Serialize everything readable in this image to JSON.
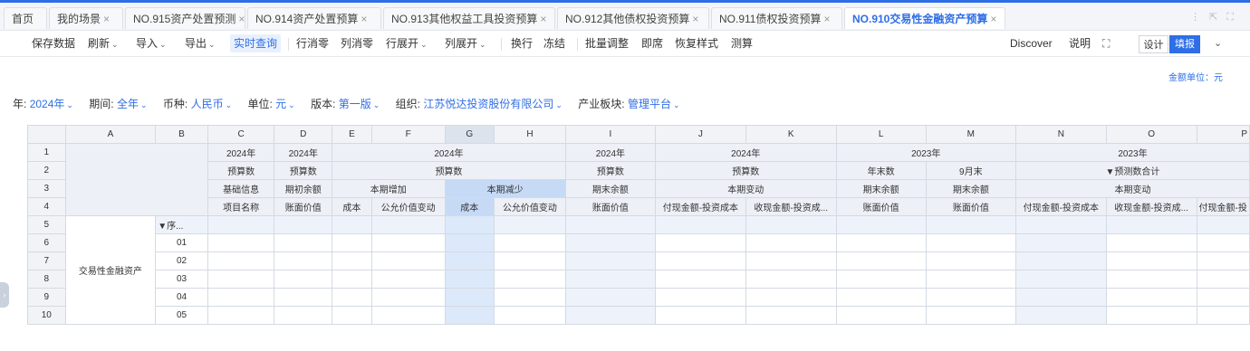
{
  "tabs": [
    {
      "label": "首页",
      "close": ""
    },
    {
      "label": "我的场景",
      "close": "×"
    },
    {
      "label": "NO.915资产处置预测",
      "close": "×"
    },
    {
      "label": "NO.914资产处置预算",
      "close": "×"
    },
    {
      "label": "NO.913其他权益工具投资预算",
      "close": "×"
    },
    {
      "label": "NO.912其他债权投资预算",
      "close": "×"
    },
    {
      "label": "NO.911债权投资预算",
      "close": "×"
    },
    {
      "label": "NO.910交易性金融资产预算",
      "close": "×"
    }
  ],
  "toolbar": {
    "save": "保存数据",
    "refresh": "刷新",
    "import": "导入",
    "export": "导出",
    "realtime": "实时查询",
    "row_zero": "行消零",
    "col_zero": "列消零",
    "row_expand": "行展开",
    "col_expand": "列展开",
    "wrap": "换行",
    "freeze": "冻结",
    "batch": "批量调整",
    "instant": "即席",
    "restore": "恢复样式",
    "test": "测算",
    "discover": "Discover",
    "help": "说明",
    "design": "设计",
    "fill": "填报"
  },
  "unit_label": "金额单位：元",
  "filters": [
    {
      "label": "年:",
      "value": "2024年"
    },
    {
      "label": "期间:",
      "value": "全年"
    },
    {
      "label": "币种:",
      "value": "人民币"
    },
    {
      "label": "单位:",
      "value": "元"
    },
    {
      "label": "版本:",
      "value": "第一版"
    },
    {
      "label": "组织:",
      "value": "江苏悦达投资股份有限公司"
    },
    {
      "label": "产业板块:",
      "value": "管理平台"
    }
  ],
  "grid": {
    "columns": [
      "A",
      "B",
      "C",
      "D",
      "E",
      "F",
      "G",
      "H",
      "I",
      "J",
      "K",
      "L",
      "M",
      "N",
      "O",
      "P"
    ],
    "row_numbers": [
      "1",
      "2",
      "3",
      "4",
      "5",
      "6",
      "7",
      "8",
      "9",
      "10"
    ],
    "r1": {
      "c": "2024年",
      "d": "2024年",
      "efgh": "2024年",
      "i": "2024年",
      "jk": "2024年",
      "lm": "2023年",
      "nop": "2023年"
    },
    "r2": {
      "c": "预算数",
      "d": "预算数",
      "efgh": "预算数",
      "i": "预算数",
      "jk": "预算数",
      "l": "年末数",
      "m": "9月末",
      "nop": "▼预测数合计"
    },
    "r3": {
      "c": "基础信息",
      "d": "期初余额",
      "ef": "本期增加",
      "gh": "本期减少",
      "i": "期末余额",
      "jk": "本期变动",
      "l": "期末余额",
      "m": "期末余额",
      "nop": "本期变动"
    },
    "r4": {
      "c": "项目名称",
      "d": "账面价值",
      "e": "成本",
      "f": "公允价值变动",
      "g": "成本",
      "h": "公允价值变动",
      "i": "账面价值",
      "j": "付现金额-投资成本",
      "k": "收现金额-投资成...",
      "l": "账面价值",
      "m": "账面价值",
      "n": "付现金额-投资成本",
      "o": "收现金额-投资成...",
      "p": "付现金额-投"
    },
    "seq_header": "▼序...",
    "group_label": "交易性金融资产",
    "seq": [
      "01",
      "02",
      "03",
      "04",
      "05"
    ]
  }
}
